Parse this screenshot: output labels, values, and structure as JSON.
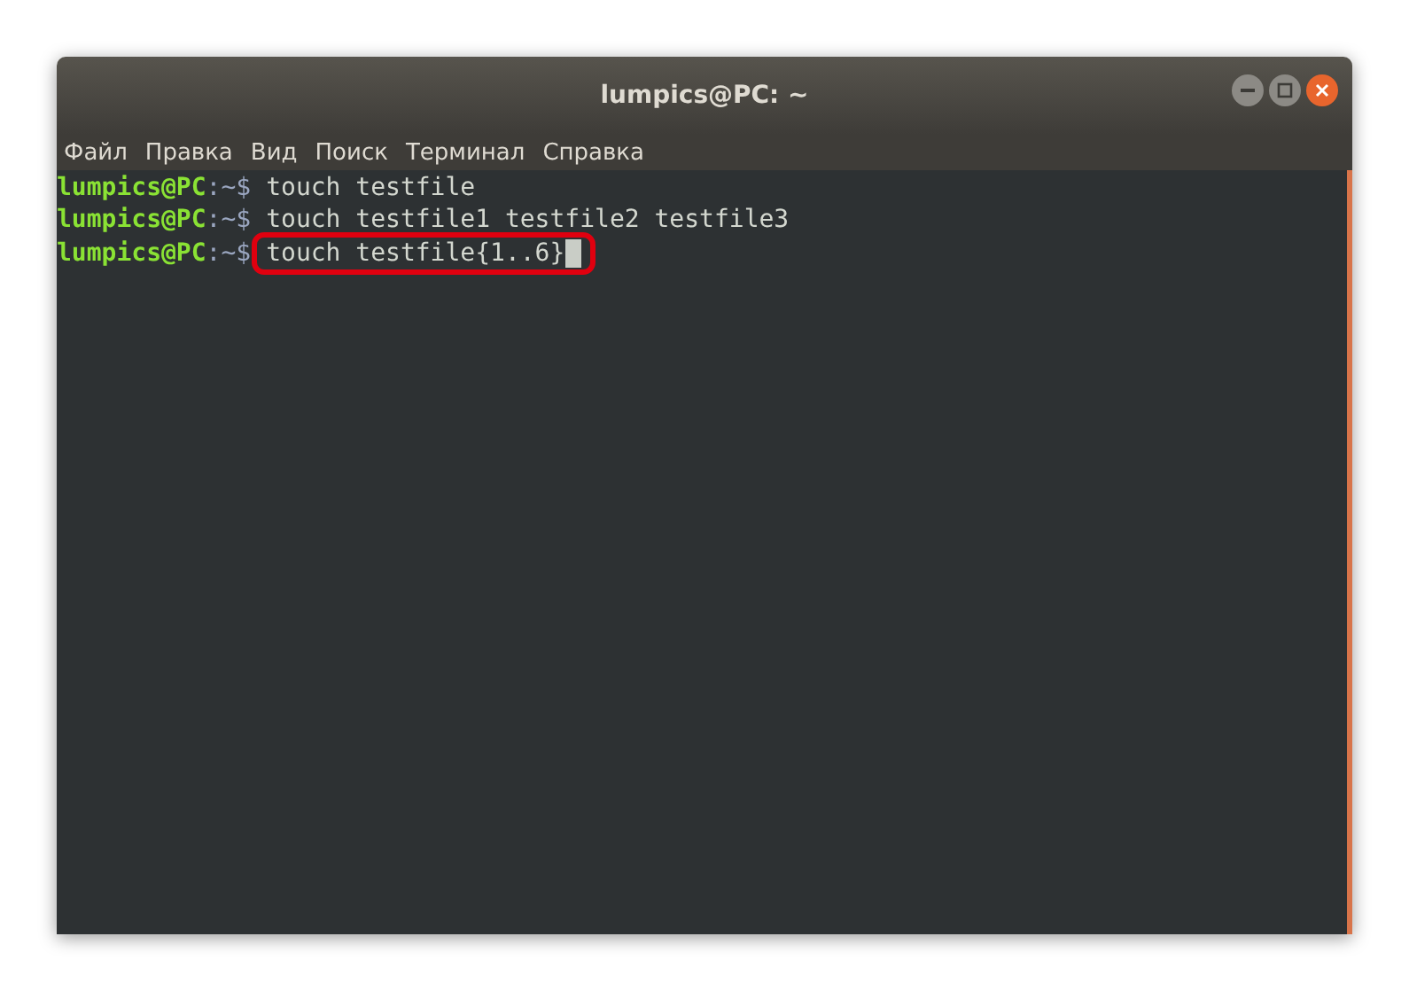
{
  "window": {
    "title": "lumpics@PC: ~"
  },
  "menu": [
    "Файл",
    "Правка",
    "Вид",
    "Поиск",
    "Терминал",
    "Справка"
  ],
  "lines": [
    {
      "user": "lumpics@PC",
      "path": ":~$",
      "command": "touch testfile",
      "cursor": false,
      "highlighted": false
    },
    {
      "user": "lumpics@PC",
      "path": ":~$",
      "command": "touch testfile1 testfile2 testfile3",
      "cursor": false,
      "highlighted": false
    },
    {
      "user": "lumpics@PC",
      "path": ":~$",
      "command": "touch testfile{1..6}",
      "cursor": true,
      "highlighted": true
    }
  ]
}
